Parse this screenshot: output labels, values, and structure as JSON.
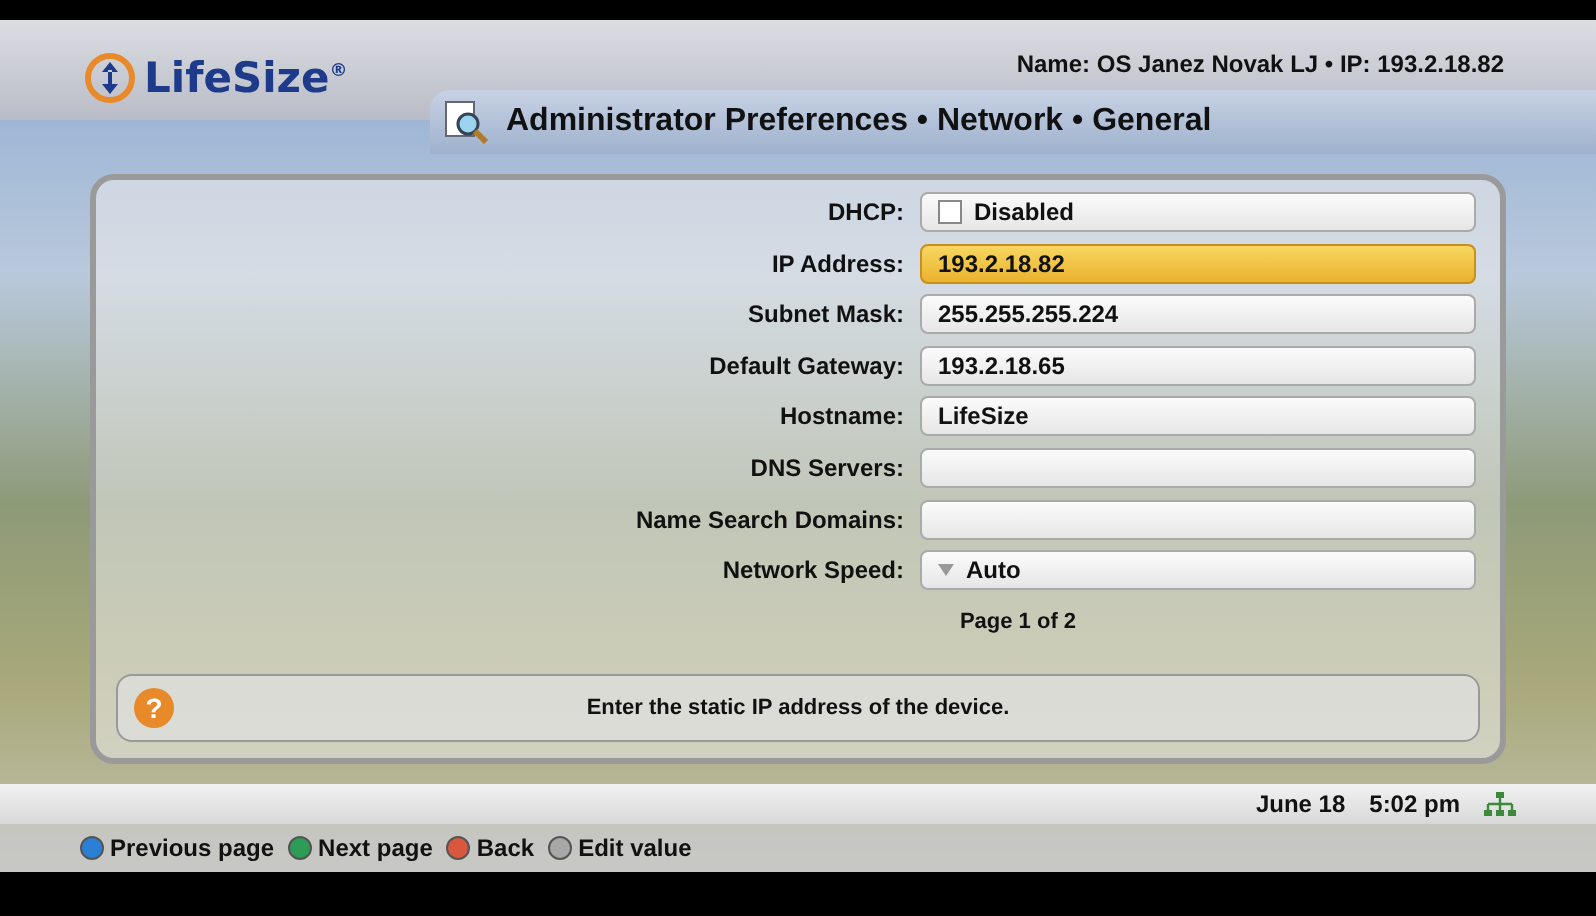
{
  "header": {
    "logo": "LifeSize",
    "logo_mark": "®",
    "device_info": "Name: OS Janez Novak LJ • IP: 193.2.18.82"
  },
  "title": "Administrator Preferences • Network • General",
  "fields": [
    {
      "label": "DHCP:",
      "kind": "checkbox",
      "value": "Disabled",
      "checked": false,
      "selected": false
    },
    {
      "label": "IP Address:",
      "kind": "text",
      "value": "193.2.18.82",
      "selected": true
    },
    {
      "label": "Subnet Mask:",
      "kind": "text",
      "value": "255.255.255.224",
      "selected": false
    },
    {
      "label": "Default Gateway:",
      "kind": "text",
      "value": "193.2.18.65",
      "selected": false
    },
    {
      "label": "Hostname:",
      "kind": "text",
      "value": "LifeSize",
      "selected": false
    },
    {
      "label": "DNS Servers:",
      "kind": "text",
      "selected": false
    },
    {
      "label": "Name Search Domains:",
      "kind": "text",
      "selected": false
    },
    {
      "label": "Network Speed:",
      "kind": "dropdown",
      "value": "Auto",
      "selected": false
    }
  ],
  "pager": "Page 1 of 2",
  "help": {
    "icon": "?",
    "text": "Enter the static IP address of the device."
  },
  "status_bar": {
    "date": "June 18",
    "time": "5:02 pm"
  },
  "legend": [
    {
      "label": "Previous page",
      "color": "#2b7fd4"
    },
    {
      "label": "Next page",
      "color": "#2e9b56"
    },
    {
      "label": "Back",
      "color": "#d9573f"
    },
    {
      "label": "Edit value",
      "color": "#a8a8a8"
    }
  ]
}
